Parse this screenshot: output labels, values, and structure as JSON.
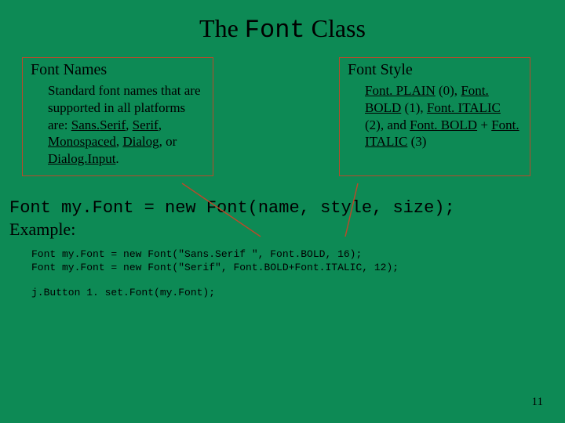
{
  "title": {
    "pre": "The ",
    "mono": "Font",
    "post": " Class"
  },
  "leftBox": {
    "heading": "Font Names",
    "body_html": "Standard font names that are supported in all platforms are: <span class=\"u\">Sans.</span><span class=\"u\">Serif</span>, <span class=\"u\">Serif</span>, <span class=\"u\">Monospaced</span>, <span class=\"u\">Dialog</span>, or <span class=\"u\">Dialog.</span><span class=\"u\">Input</span>."
  },
  "rightBox": {
    "heading": "Font Style",
    "body_html": "<span class=\"u\">Font. PLAIN</span> (0), <span class=\"u\">Font. BOLD</span> (1), <span class=\"u\">Font. ITALIC</span> (2), and <span class=\"u\">Font. BOLD</span> + <span class=\"u\">Font. ITALIC</span> (3)"
  },
  "constructorLine": "Font my.Font = new Font(name, style, size);",
  "exampleLabel": "Example:",
  "exampleCode1": "Font my.Font = new Font(\"Sans.Serif \", Font.BOLD, 16);\nFont my.Font = new Font(\"Serif\", Font.BOLD+Font.ITALIC, 12);",
  "exampleCode2": "j.Button 1. set.Font(my.Font);",
  "pageNumber": "11"
}
